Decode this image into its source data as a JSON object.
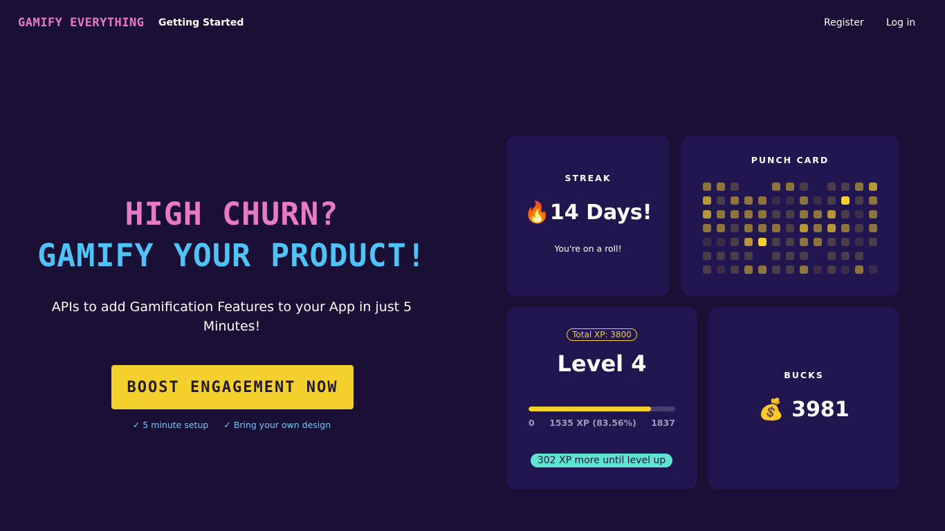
{
  "nav": {
    "logo": "GAMIFY EVERYTHING",
    "getting_started": "Getting Started",
    "register": "Register",
    "login": "Log in"
  },
  "hero": {
    "line1": "HIGH CHURN?",
    "line2": "GAMIFY YOUR PRODUCT!",
    "subtitle": "APIs to add Gamification Features to your App in just 5 Minutes!",
    "cta_label": "BOOST ENGAGEMENT NOW",
    "features": [
      {
        "icon": "check-icon",
        "label": "5 minute setup"
      },
      {
        "icon": "check-icon",
        "label": "Bring your own design"
      }
    ]
  },
  "streak": {
    "label": "STREAK",
    "icon": "fire-icon",
    "value": "14 Days!",
    "note": "You're on a roll!"
  },
  "punch_card": {
    "label": "PUNCH CARD",
    "colors": [
      "transparent",
      "#3a2c4a",
      "#4a3c48",
      "#8c743c",
      "#b8973a",
      "#f4d02c"
    ],
    "rows": [
      [
        3,
        3,
        2,
        0,
        0,
        3,
        3,
        2,
        0,
        2,
        2,
        3,
        4
      ],
      [
        4,
        2,
        3,
        3,
        3,
        1,
        1,
        3,
        1,
        2,
        5,
        2,
        3
      ],
      [
        4,
        3,
        3,
        3,
        3,
        2,
        2,
        3,
        3,
        4,
        2,
        1,
        3
      ],
      [
        3,
        3,
        2,
        3,
        3,
        3,
        2,
        4,
        3,
        4,
        3,
        2,
        3
      ],
      [
        1,
        1,
        2,
        4,
        5,
        2,
        2,
        3,
        3,
        2,
        2,
        1,
        2
      ],
      [
        2,
        2,
        2,
        2,
        0,
        2,
        2,
        2,
        0,
        2,
        2,
        2,
        0
      ],
      [
        2,
        1,
        2,
        3,
        3,
        2,
        2,
        3,
        1,
        2,
        1,
        3,
        1
      ]
    ]
  },
  "level": {
    "total_xp": "Total XP: 3800",
    "value": "Level 4",
    "progress": 0.8356,
    "min": "0",
    "xp_label": "1535 XP (83.56%)",
    "max": "1837",
    "levelup": "302 XP more until level up"
  },
  "bucks": {
    "label": "BUCKS",
    "icon": "coin-icon",
    "value": "3981"
  },
  "colors": {
    "background": "#1a1035",
    "card": "#221650",
    "pink": "#e879c7",
    "blue": "#4fc3f7",
    "yellow": "#f4d02c",
    "teal": "#5de3cf"
  }
}
